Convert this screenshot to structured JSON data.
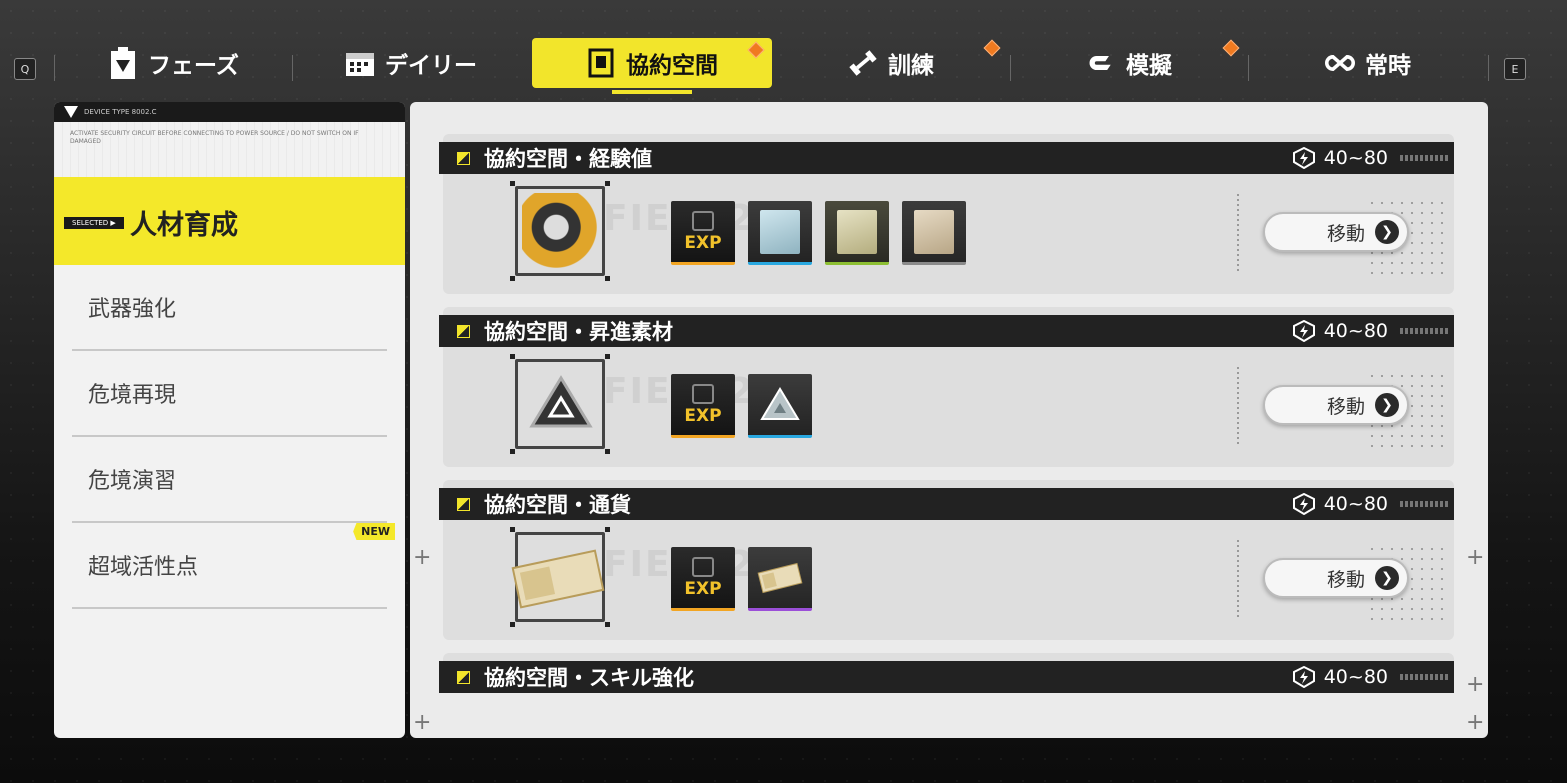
{
  "top_nav": {
    "left_key": "Q",
    "right_key": "E",
    "tabs": [
      {
        "label": "フェーズ",
        "icon": "clipboard-icon",
        "badge": false
      },
      {
        "label": "デイリー",
        "icon": "calendar-icon",
        "badge": false
      },
      {
        "label": "協約空間",
        "icon": "portal-icon",
        "badge": true,
        "active": true
      },
      {
        "label": "訓練",
        "icon": "dumbbell-icon",
        "badge": true
      },
      {
        "label": "模擬",
        "icon": "simulation-icon",
        "badge": true
      },
      {
        "label": "常時",
        "icon": "infinity-icon",
        "badge": false
      }
    ]
  },
  "sidebar": {
    "header": "DEVICE TYPE 8002.C",
    "fine_print": "ACTIVATE SECURITY CIRCUIT BEFORE CONNECTING TO POWER SOURCE / DO NOT SWITCH ON IF DAMAGED",
    "selected_tag": "SELECTED ▶",
    "selected_label": "人材育成",
    "items": [
      {
        "label": "武器強化"
      },
      {
        "label": "危境再現"
      },
      {
        "label": "危境演習"
      },
      {
        "label": "超域活性点",
        "badge": "NEW"
      }
    ]
  },
  "cards": [
    {
      "title": "協約空間・経験値",
      "level": "40~80",
      "button": "移動",
      "watermark": "FIEL -21",
      "rewards": [
        {
          "type": "exp",
          "label": "EXP"
        },
        {
          "type": "blue"
        },
        {
          "type": "green"
        },
        {
          "type": "grey"
        }
      ]
    },
    {
      "title": "協約空間・昇進素材",
      "level": "40~80",
      "button": "移動",
      "watermark": "FIEL -21",
      "rewards": [
        {
          "type": "exp",
          "label": "EXP"
        },
        {
          "type": "blue"
        }
      ]
    },
    {
      "title": "協約空間・通貨",
      "level": "40~80",
      "button": "移動",
      "watermark": "FIEL -21",
      "rewards": [
        {
          "type": "exp",
          "label": "EXP"
        },
        {
          "type": "purple"
        }
      ]
    },
    {
      "title": "協約空間・スキル強化",
      "level": "40~80"
    }
  ],
  "colors": {
    "accent": "#f2e52b",
    "badge": "#f07a20"
  }
}
